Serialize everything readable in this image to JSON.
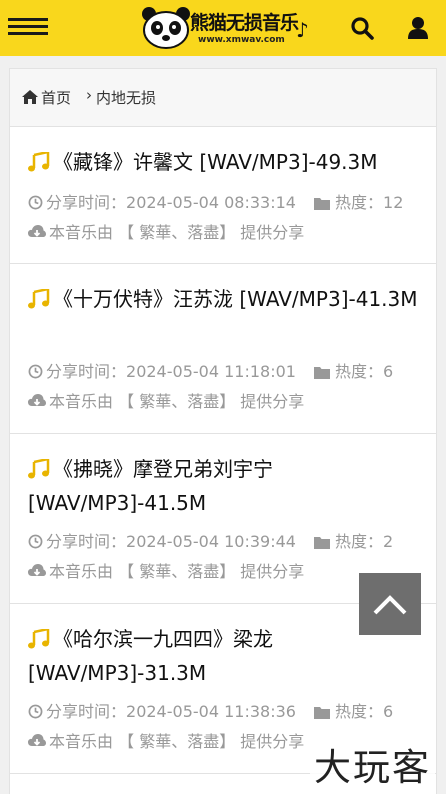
{
  "header": {
    "logo_title": "熊猫无损音乐",
    "logo_url": "www.xmwav.com",
    "logo_note": "♪"
  },
  "breadcrumb": {
    "home": "首页",
    "current": "内地无损"
  },
  "items": [
    {
      "title": "《藏锋》许馨文 [WAV/MP3]-49.3M",
      "time_label": "分享时间：",
      "time": "2024-05-04 08:33:14",
      "heat_label": "热度：",
      "heat": "12",
      "share_prefix": "本音乐由",
      "sharer": "【 繁華、落盡】",
      "share_suffix": "提供分享"
    },
    {
      "title": "《十万伏特》汪苏泷 [WAV/MP3]-41.3M",
      "time_label": "分享时间：",
      "time": "2024-05-04 11:18:01",
      "heat_label": "热度：",
      "heat": "6",
      "share_prefix": "本音乐由",
      "sharer": "【 繁華、落盡】",
      "share_suffix": "提供分享"
    },
    {
      "title": "《拂晓》摩登兄弟刘宇宁 [WAV/MP3]-41.5M",
      "time_label": "分享时间：",
      "time": "2024-05-04 10:39:44",
      "heat_label": "热度：",
      "heat": "2",
      "share_prefix": "本音乐由",
      "sharer": "【 繁華、落盡】",
      "share_suffix": "提供分享"
    },
    {
      "title": "《哈尔滨一九四四》梁龙 [WAV/MP3]-31.3M",
      "time_label": "分享时间：",
      "time": "2024-05-04 11:38:36",
      "heat_label": "热度：",
      "heat": "6",
      "share_prefix": "本音乐由",
      "sharer": "【 繁華、落盡】",
      "share_suffix": "提供分享"
    }
  ],
  "watermark": "大玩客",
  "colors": {
    "header_bg": "#f9d71c",
    "note_icon": "#e8b400",
    "meta_text": "#999999",
    "back_top_bg": "#6e6e6e"
  }
}
